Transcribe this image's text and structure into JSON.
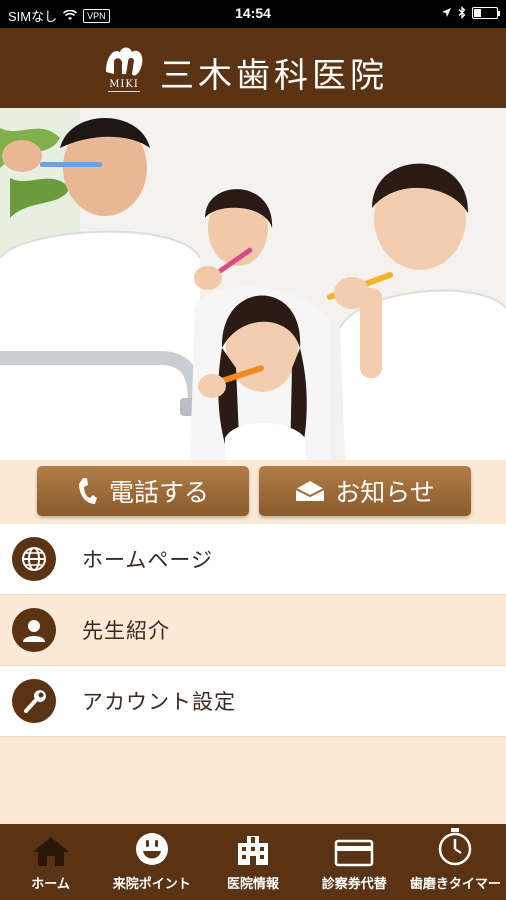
{
  "status_bar": {
    "carrier": "SIMなし",
    "vpn": "VPN",
    "time": "14:54"
  },
  "header": {
    "title": "三木歯科医院",
    "logo_text": "MIKI"
  },
  "actions": {
    "call_label": "電話する",
    "news_label": "お知らせ"
  },
  "menu": {
    "items": [
      {
        "label": "ホームページ",
        "icon": "globe-icon"
      },
      {
        "label": "先生紹介",
        "icon": "person-icon"
      },
      {
        "label": "アカウント設定",
        "icon": "wrench-icon"
      }
    ]
  },
  "tabbar": {
    "items": [
      {
        "label": "ホーム",
        "icon": "home-icon"
      },
      {
        "label": "来院ポイント",
        "icon": "smiley-icon"
      },
      {
        "label": "医院情報",
        "icon": "building-icon"
      },
      {
        "label": "診察券代替",
        "icon": "card-icon"
      },
      {
        "label": "歯磨きタイマー",
        "icon": "stopwatch-icon"
      }
    ]
  },
  "colors": {
    "brand_brown": "#5a3214",
    "button_brown": "#9a6a38",
    "beige": "#fbe9d6"
  }
}
